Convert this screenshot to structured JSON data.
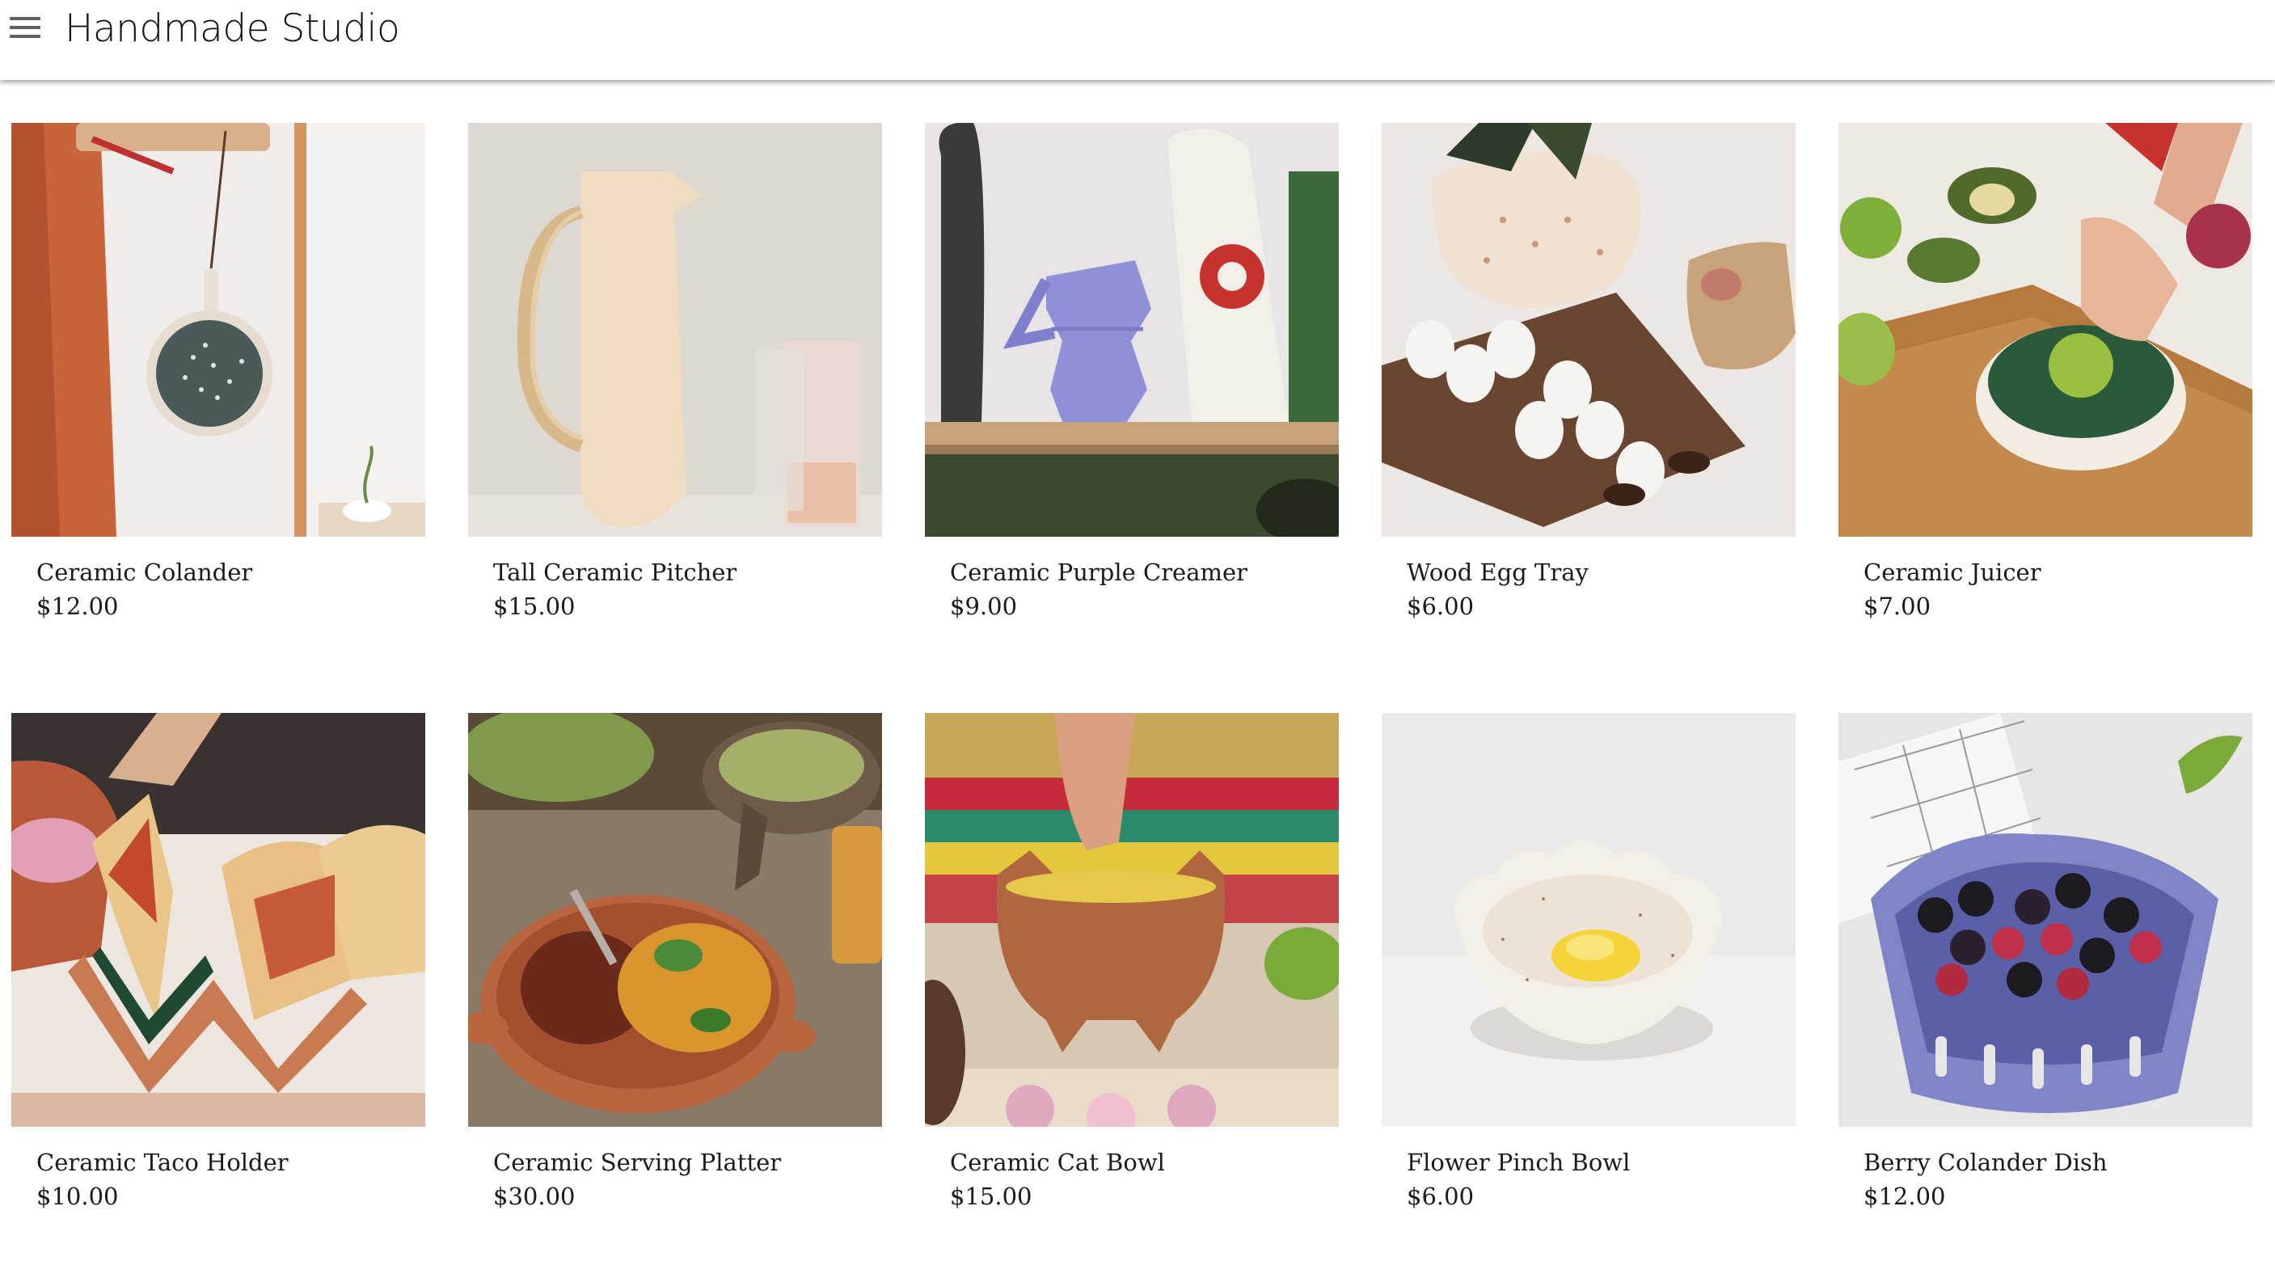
{
  "app": {
    "title": "Handmade Studio",
    "menu_icon": "hamburger-menu-icon"
  },
  "products": [
    {
      "name": "Ceramic Colander",
      "price": "$12.00",
      "image": "ceramic-colander-photo"
    },
    {
      "name": "Tall Ceramic Pitcher",
      "price": "$15.00",
      "image": "tall-ceramic-pitcher-photo"
    },
    {
      "name": "Ceramic Purple Creamer",
      "price": "$9.00",
      "image": "ceramic-purple-creamer-photo"
    },
    {
      "name": "Wood Egg Tray",
      "price": "$6.00",
      "image": "wood-egg-tray-photo"
    },
    {
      "name": "Ceramic Juicer",
      "price": "$7.00",
      "image": "ceramic-juicer-photo"
    },
    {
      "name": "Ceramic Taco Holder",
      "price": "$10.00",
      "image": "ceramic-taco-holder-photo"
    },
    {
      "name": "Ceramic Serving Platter",
      "price": "$30.00",
      "image": "ceramic-serving-platter-photo"
    },
    {
      "name": "Ceramic Cat Bowl",
      "price": "$15.00",
      "image": "ceramic-cat-bowl-photo"
    },
    {
      "name": "Flower Pinch Bowl",
      "price": "$6.00",
      "image": "flower-pinch-bowl-photo"
    },
    {
      "name": "Berry Colander Dish",
      "price": "$12.00",
      "image": "berry-colander-dish-photo"
    }
  ]
}
